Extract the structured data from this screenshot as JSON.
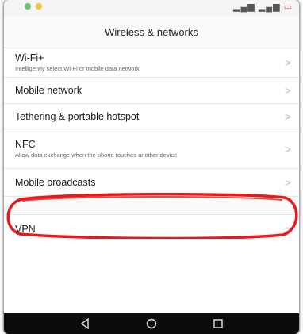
{
  "header": {
    "title": "Wireless & networks"
  },
  "settings": {
    "items": [
      {
        "title": "Wi-Fi+",
        "subtitle": "Intelligently select Wi-Fi or mobile data network"
      },
      {
        "title": "Mobile network"
      },
      {
        "title": "Tethering & portable hotspot"
      },
      {
        "title": "NFC",
        "subtitle": "Allow data exchange when the phone touches another device"
      },
      {
        "title": "Mobile broadcasts"
      },
      {
        "title": "VPN"
      }
    ],
    "chevron": ">"
  },
  "icons": {
    "status_dot_left": "green-dot-icon",
    "status_dot_right": "yellow-dot-icon",
    "back": "triangle-back-icon",
    "home": "circle-home-icon",
    "recents": "square-recents-icon"
  },
  "colors": {
    "highlight": "#e8191a",
    "navbar": "#0c0c0c"
  }
}
